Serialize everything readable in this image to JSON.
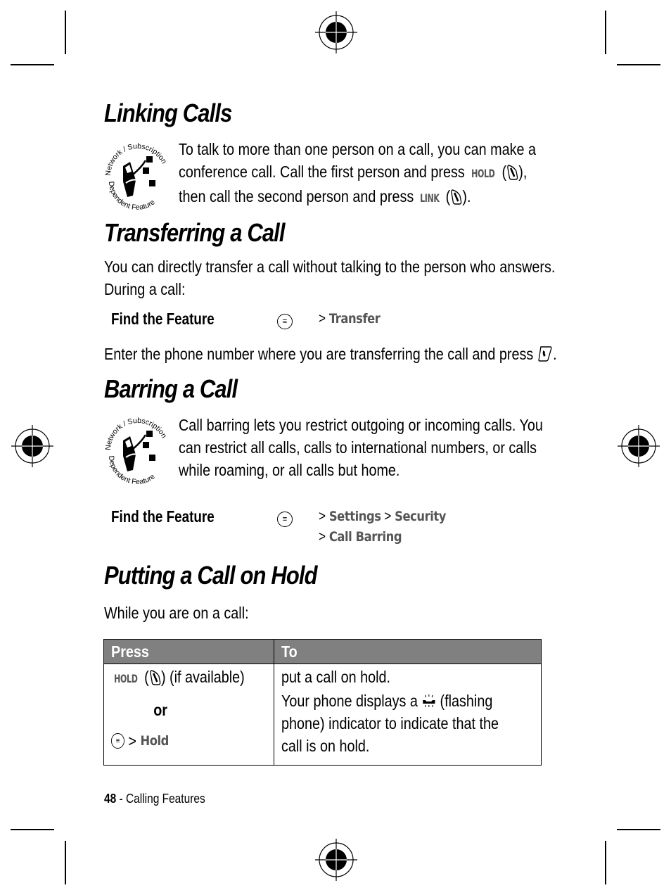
{
  "page": {
    "number": "48",
    "section": "Calling Features",
    "footer_separator": " - "
  },
  "icons": {
    "network_badge_top": "Network / Subscription",
    "network_badge_bottom": "Dependent Feature",
    "menu_key": "menu-key-icon",
    "softkey": "softkey-icon",
    "send_key": "send-key-icon",
    "flashing_phone": "flashing-phone-icon"
  },
  "linking": {
    "title": "Linking Calls",
    "line1": "To talk to more than one person on a call, you can make a",
    "line2_pre": "conference call. Call the first person and press ",
    "line2_key": "HOLD",
    "line2_post": "),",
    "line3_pre": "then call the second person and press ",
    "line3_key": "LINK",
    "line3_post": ")."
  },
  "transferring": {
    "title": "Transferring a Call",
    "line1": "You can directly transfer a call without talking to the person who answers.",
    "line2": "During a call:",
    "find_label": "Find the Feature",
    "path": [
      {
        "sep": "> ",
        "item": "Transfer"
      }
    ],
    "after_pre": "Enter the phone number where you are transferring the call and press ",
    "after_post": "."
  },
  "barring": {
    "title": "Barring a Call",
    "line1": "Call barring lets you restrict outgoing or incoming calls. You",
    "line2": "can restrict all calls, calls to international numbers, or calls",
    "line3": "while roaming, or all calls but home.",
    "find_label": "Find the Feature",
    "path_row1": [
      {
        "sep": "> ",
        "item": "Settings"
      },
      {
        "sep": " > ",
        "item": "Security"
      }
    ],
    "path_row2": [
      {
        "sep": "> ",
        "item": "Call Barring"
      }
    ]
  },
  "hold": {
    "title": "Putting a Call on Hold",
    "intro": "While you are on a call:",
    "table": {
      "headers": [
        "Press",
        "To"
      ],
      "press_key": "HOLD",
      "press_suffix": ") (if available)",
      "or": "or",
      "menu_sep": " > ",
      "menu_item": "Hold",
      "to_line1": "put a call on hold.",
      "to_line2_pre": "Your phone displays a ",
      "to_line2_post": " (flashing",
      "to_line3": "phone) indicator to indicate that the",
      "to_line4": "call is on hold."
    }
  }
}
